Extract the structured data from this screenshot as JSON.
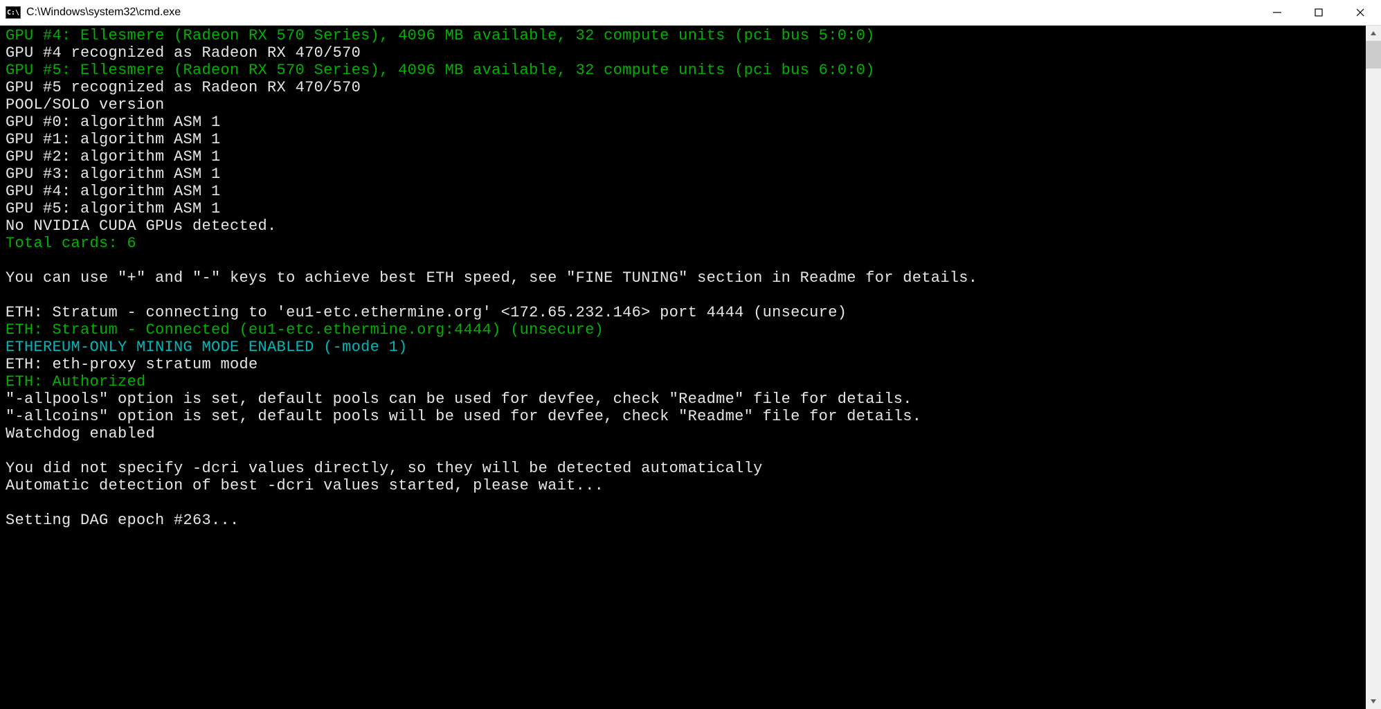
{
  "window": {
    "title": "C:\\Windows\\system32\\cmd.exe",
    "icon_label": "C:\\"
  },
  "terminal": {
    "lines": [
      {
        "color": "green",
        "text": "GPU #4: Ellesmere (Radeon RX 570 Series), 4096 MB available, 32 compute units (pci bus 5:0:0)"
      },
      {
        "color": "white",
        "text": "GPU #4 recognized as Radeon RX 470/570"
      },
      {
        "color": "green",
        "text": "GPU #5: Ellesmere (Radeon RX 570 Series), 4096 MB available, 32 compute units (pci bus 6:0:0)"
      },
      {
        "color": "white",
        "text": "GPU #5 recognized as Radeon RX 470/570"
      },
      {
        "color": "white",
        "text": "POOL/SOLO version"
      },
      {
        "color": "white",
        "text": "GPU #0: algorithm ASM 1"
      },
      {
        "color": "white",
        "text": "GPU #1: algorithm ASM 1"
      },
      {
        "color": "white",
        "text": "GPU #2: algorithm ASM 1"
      },
      {
        "color": "white",
        "text": "GPU #3: algorithm ASM 1"
      },
      {
        "color": "white",
        "text": "GPU #4: algorithm ASM 1"
      },
      {
        "color": "white",
        "text": "GPU #5: algorithm ASM 1"
      },
      {
        "color": "white",
        "text": "No NVIDIA CUDA GPUs detected."
      },
      {
        "color": "green",
        "text": "Total cards: 6"
      },
      {
        "color": "white",
        "text": ""
      },
      {
        "color": "white",
        "text": "You can use \"+\" and \"-\" keys to achieve best ETH speed, see \"FINE TUNING\" section in Readme for details."
      },
      {
        "color": "white",
        "text": ""
      },
      {
        "color": "white",
        "text": "ETH: Stratum - connecting to 'eu1-etc.ethermine.org' <172.65.232.146> port 4444 (unsecure)"
      },
      {
        "color": "green",
        "text": "ETH: Stratum - Connected (eu1-etc.ethermine.org:4444) (unsecure)"
      },
      {
        "color": "cyan",
        "text": "ETHEREUM-ONLY MINING MODE ENABLED (-mode 1)"
      },
      {
        "color": "white",
        "text": "ETH: eth-proxy stratum mode"
      },
      {
        "color": "green",
        "text": "ETH: Authorized"
      },
      {
        "color": "white",
        "text": "\"-allpools\" option is set, default pools can be used for devfee, check \"Readme\" file for details."
      },
      {
        "color": "white",
        "text": "\"-allcoins\" option is set, default pools will be used for devfee, check \"Readme\" file for details."
      },
      {
        "color": "white",
        "text": "Watchdog enabled"
      },
      {
        "color": "white",
        "text": ""
      },
      {
        "color": "white",
        "text": "You did not specify -dcri values directly, so they will be detected automatically"
      },
      {
        "color": "white",
        "text": "Automatic detection of best -dcri values started, please wait..."
      },
      {
        "color": "white",
        "text": ""
      },
      {
        "color": "white",
        "text": "Setting DAG epoch #263..."
      }
    ]
  }
}
